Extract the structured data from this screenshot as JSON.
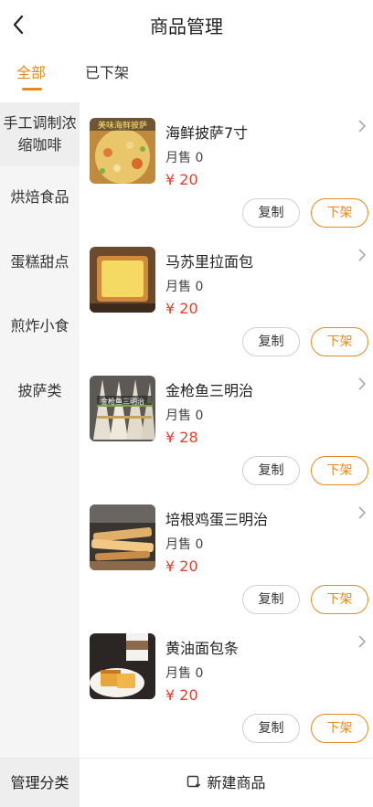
{
  "header": {
    "title": "商品管理"
  },
  "tabs": [
    {
      "label": "全部"
    },
    {
      "label": "已下架"
    }
  ],
  "categories": [
    {
      "label": "手工调制浓缩咖啡"
    },
    {
      "label": "烘焙食品"
    },
    {
      "label": "蛋糕甜点"
    },
    {
      "label": "煎炸小食"
    },
    {
      "label": "披萨类"
    }
  ],
  "products": [
    {
      "name": "海鲜披萨7寸",
      "sold": "月售 0",
      "price": "¥ 20",
      "thumb_text": "美味海鲜披萨"
    },
    {
      "name": "马苏里拉面包",
      "sold": "月售 0",
      "price": "¥ 20"
    },
    {
      "name": "金枪鱼三明治",
      "sold": "月售 0",
      "price": "¥ 28",
      "thumb_text": "金枪鱼三明治"
    },
    {
      "name": "培根鸡蛋三明治",
      "sold": "月售 0",
      "price": "¥ 20"
    },
    {
      "name": "黄油面包条",
      "sold": "月售 0",
      "price": "¥ 20"
    }
  ],
  "buttons": {
    "copy": "复制",
    "off_shelf": "下架"
  },
  "footer": {
    "manage": "管理分类",
    "new_product": "新建商品"
  },
  "colors": {
    "accent": "#e8891c",
    "price": "#e53e2b"
  }
}
